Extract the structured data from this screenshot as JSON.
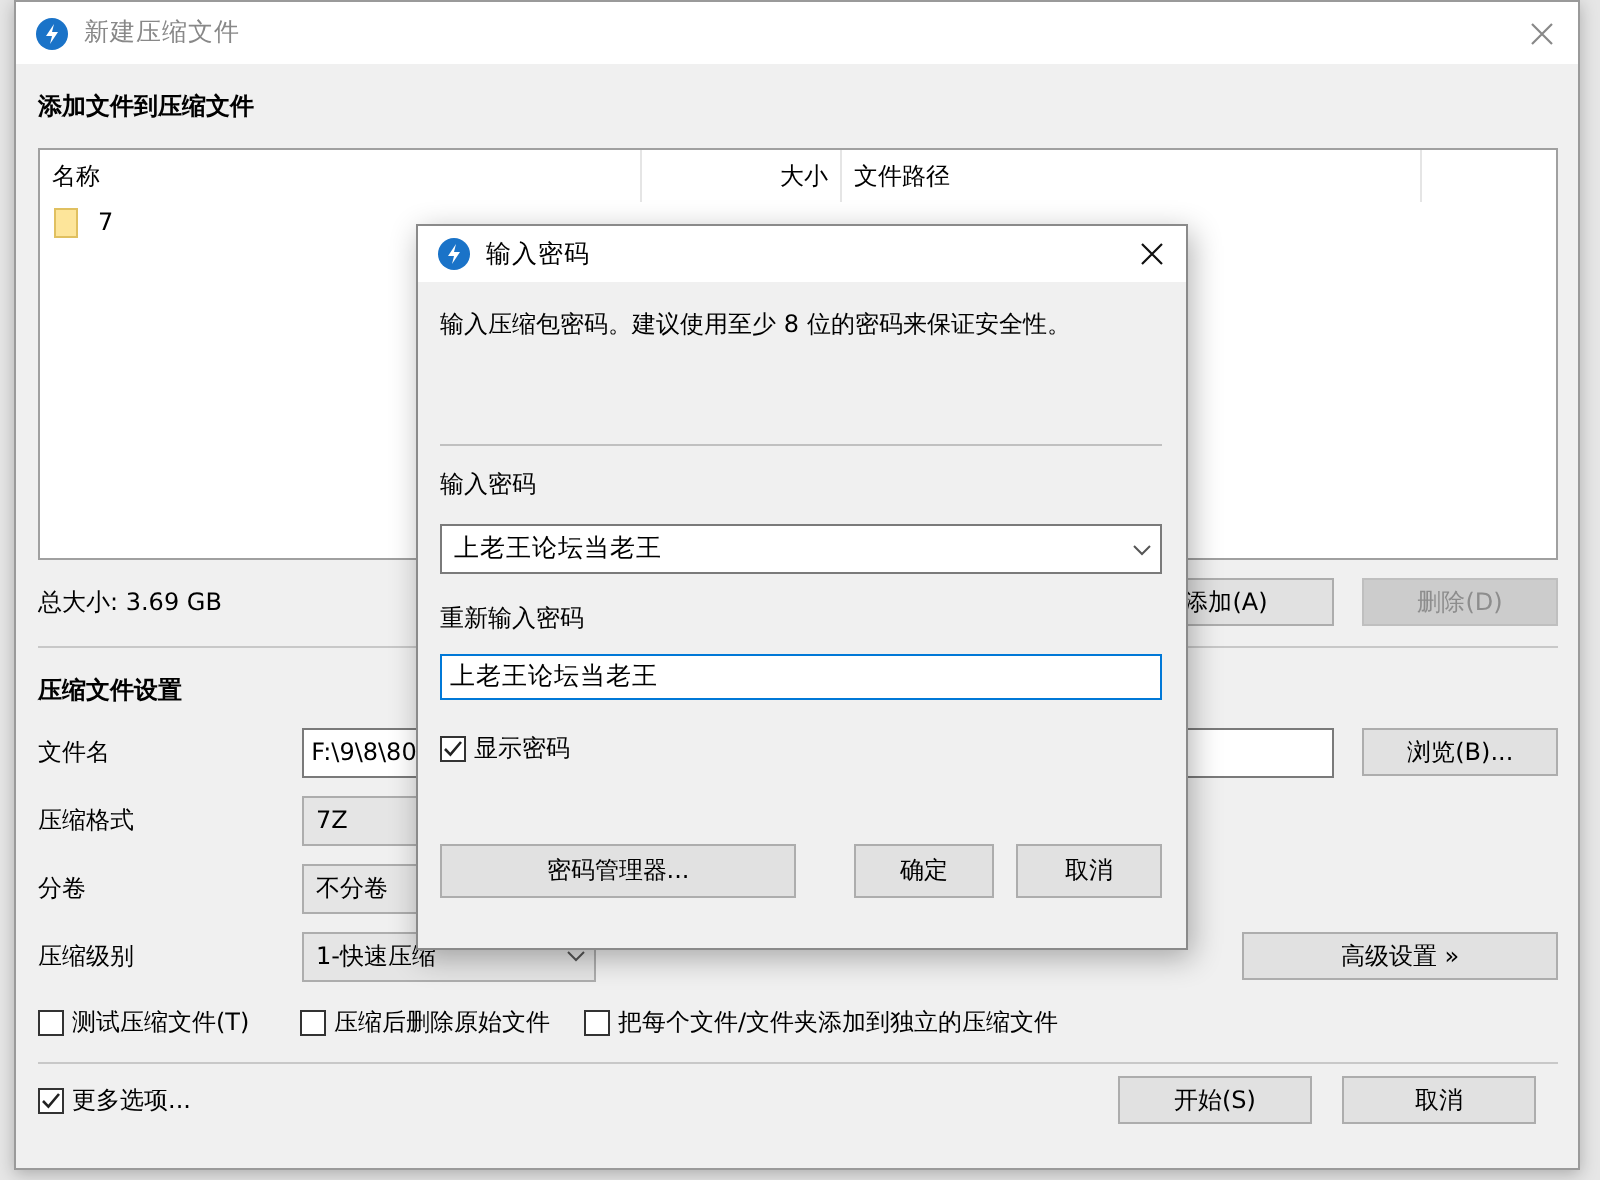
{
  "window": {
    "title": "新建压缩文件"
  },
  "files_section": {
    "heading": "添加文件到压缩文件",
    "columns": [
      "名称",
      "大小",
      "文件路径"
    ],
    "rows": [
      {
        "name": "7"
      }
    ],
    "total": "总大小: 3.69 GB",
    "buttons": [
      {
        "label": "添加(A)",
        "disabled": false
      },
      {
        "label": "删除(D)",
        "disabled": true
      }
    ]
  },
  "settings": {
    "heading": "压缩文件设置",
    "fields": [
      {
        "kind": "text",
        "label": "文件名",
        "value": "F:\\9\\8\\80",
        "button": "浏览(B)..."
      },
      {
        "kind": "select",
        "label": "压缩格式",
        "value": "7Z"
      },
      {
        "kind": "select",
        "label": "分卷",
        "value": "不分卷"
      },
      {
        "kind": "dropdown",
        "label": "压缩级别",
        "value": "1-快速压缩",
        "button": "高级设置 »"
      }
    ],
    "options": [
      {
        "label": "测试压缩文件(T)",
        "checked": false
      },
      {
        "label": "压缩后删除原始文件",
        "checked": false
      },
      {
        "label": "把每个文件/文件夹添加到独立的压缩文件",
        "checked": false
      }
    ]
  },
  "footer": {
    "more_options": {
      "label": "更多选项...",
      "checked": true
    },
    "buttons": [
      "开始(S)",
      "取消"
    ]
  },
  "dialog": {
    "title": "输入密码",
    "description": "输入压缩包密码。建议使用至少 8 位的密码来保证安全性。",
    "password_label": "输入密码",
    "password": "上老王论坛当老王",
    "confirm_label": "重新输入密码",
    "confirm": "上老王论坛当老王",
    "show_password": {
      "label": "显示密码",
      "checked": true
    },
    "buttons": [
      "密码管理器...",
      "确定",
      "取消"
    ]
  }
}
